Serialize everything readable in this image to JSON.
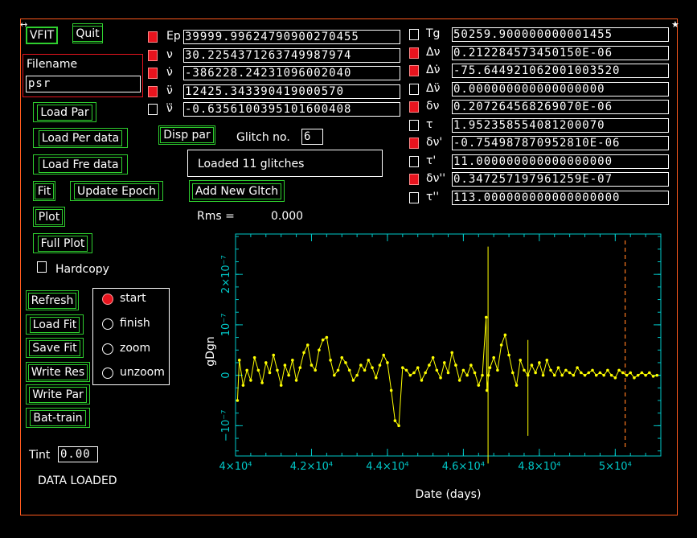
{
  "app": {
    "title": "VFIT",
    "quit_label": "Quit",
    "status": "DATA LOADED"
  },
  "file": {
    "label": "Filename",
    "value": "psr"
  },
  "buttons": {
    "load_par": "Load Par",
    "load_per": "Load Per data",
    "load_fre": "Load Fre data",
    "fit": "Fit",
    "update_epoch": "Update Epoch",
    "plot": "Plot",
    "full_plot": "Full Plot",
    "hardcopy": "Hardcopy",
    "refresh": "Refresh",
    "load_fit": "Load Fit",
    "save_fit": "Save Fit",
    "write_res": "Write Res",
    "write_par": "Write Par",
    "bat_train": "Bat-train",
    "disp_par": "Disp par",
    "add_glitch": "Add New Gltch"
  },
  "glitch": {
    "label": "Glitch no.",
    "value": "6",
    "message": "Loaded 11 glitches"
  },
  "rms": {
    "label": "Rms =",
    "value": "0.000"
  },
  "tint": {
    "label": "Tint",
    "value": "0.00"
  },
  "modes": [
    {
      "label": "start",
      "selected": true
    },
    {
      "label": "finish",
      "selected": false
    },
    {
      "label": "zoom",
      "selected": false
    },
    {
      "label": "unzoom",
      "selected": false
    }
  ],
  "params_left": [
    {
      "name": "Ep",
      "checked": true,
      "value": "39999.99624790900270455"
    },
    {
      "name": "ν",
      "checked": true,
      "value": "30.2254371263749987974"
    },
    {
      "name": "ν̇",
      "checked": true,
      "value": "-386228.24231096002040"
    },
    {
      "name": "ν̈",
      "checked": true,
      "value": "12425.343390419000570"
    },
    {
      "name": "ν⃛",
      "checked": false,
      "value": "-0.6356100395101600408"
    }
  ],
  "params_right": [
    {
      "name": "Tg",
      "checked": false,
      "value": "50259.900000000001455"
    },
    {
      "name": "Δν",
      "checked": true,
      "value": "0.212284573450150E-06"
    },
    {
      "name": "Δν̇",
      "checked": true,
      "value": "-75.644921062001003520"
    },
    {
      "name": "Δν̈",
      "checked": false,
      "value": "0.000000000000000000"
    },
    {
      "name": "δν",
      "checked": true,
      "value": "0.207264568269070E-06"
    },
    {
      "name": "τ",
      "checked": false,
      "value": "1.952358554081200070"
    },
    {
      "name": "δν'",
      "checked": true,
      "value": "-0.754987870952810E-06"
    },
    {
      "name": "τ'",
      "checked": false,
      "value": "11.000000000000000000"
    },
    {
      "name": "δν''",
      "checked": true,
      "value": "0.347257197961259E-07"
    },
    {
      "name": "τ''",
      "checked": false,
      "value": "113.000000000000000000"
    }
  ],
  "colors": {
    "axis": "#00c8c8",
    "data": "#ffff00",
    "marker": "#ff7a1e",
    "frame": "#ff5a1e",
    "button": "#2fd02f"
  },
  "chart_data": {
    "type": "line",
    "xlabel": "Date (days)",
    "ylabel": "gDgn",
    "xlim": [
      40000,
      51200
    ],
    "ylim": [
      -1.6e-07,
      2.8e-07
    ],
    "xticks": [
      40000,
      42000,
      44000,
      46000,
      48000,
      50000
    ],
    "xtick_labels": [
      "4×10⁴",
      "4.2×10⁴",
      "4.4×10⁴",
      "4.6×10⁴",
      "4.8×10⁴",
      "5×10⁴"
    ],
    "yticks": [
      -1e-07,
      0,
      1e-07,
      2e-07
    ],
    "ytick_labels": [
      "−10⁻⁷",
      "0",
      "10⁻⁷",
      "2×10⁻⁷"
    ],
    "glitch_marker_x": 50259.9,
    "series": [
      {
        "x": [
          40050,
          40100,
          40200,
          40300,
          40400,
          40500,
          40600,
          40700,
          40800,
          40900,
          41000,
          41100,
          41200,
          41300,
          41400,
          41500,
          41600,
          41700,
          41800,
          41900,
          42000,
          42100,
          42200,
          42300,
          42400,
          42500,
          42600,
          42700,
          42800,
          42900,
          43000,
          43100,
          43200,
          43300,
          43400,
          43500,
          43600,
          43700,
          43800,
          43900,
          44000,
          44100,
          44200,
          44300,
          44400,
          44500,
          44600,
          44700,
          44800,
          44900,
          45000,
          45100,
          45200,
          45300,
          45400,
          45500,
          45600,
          45700,
          45800,
          45900,
          46000,
          46100,
          46200,
          46300,
          46400,
          46500,
          46600,
          46620,
          46660,
          46700,
          46800,
          46900,
          47000,
          47100,
          47200,
          47300,
          47400,
          47500,
          47600,
          47700,
          47800,
          47900,
          48000,
          48100,
          48200,
          48300,
          48400,
          48500,
          48600,
          48700,
          48800,
          48900,
          49000,
          49100,
          49200,
          49300,
          49400,
          49500,
          49600,
          49700,
          49800,
          49900,
          50000,
          50100,
          50200,
          50300,
          50400,
          50500,
          50600,
          50700,
          50800,
          50900,
          51000,
          51100
        ],
        "y": [
          -5e-08,
          3e-08,
          -2e-08,
          1e-08,
          -1e-08,
          3.5e-08,
          1e-08,
          -1.5e-08,
          2.5e-08,
          5e-09,
          4e-08,
          1e-08,
          -2e-08,
          2e-08,
          0.0,
          3e-08,
          -1e-08,
          1.5e-08,
          4.5e-08,
          6e-08,
          2e-08,
          1e-08,
          5e-08,
          7e-08,
          7.5e-08,
          3e-08,
          0.0,
          1e-08,
          3.5e-08,
          2.5e-08,
          1e-08,
          -1e-08,
          0.0,
          2e-08,
          1e-08,
          3e-08,
          1.5e-08,
          -5e-09,
          2e-08,
          4e-08,
          2.5e-08,
          -3e-08,
          -9e-08,
          -1e-07,
          1.5e-08,
          1e-08,
          0.0,
          5e-09,
          1.5e-08,
          -1e-08,
          5e-09,
          2e-08,
          3.5e-08,
          1e-08,
          -5e-09,
          2.5e-08,
          5e-09,
          4.5e-08,
          2e-08,
          -1e-08,
          1e-08,
          0.0,
          2e-08,
          5e-09,
          -2e-08,
          0.0,
          1.15e-07,
          -3e-08,
          0.0,
          1.5e-08,
          3.5e-08,
          1e-08,
          6e-08,
          8e-08,
          4e-08,
          5e-09,
          -2e-08,
          3e-08,
          1e-08,
          0.0,
          2e-08,
          5e-09,
          2.5e-08,
          0.0,
          3e-08,
          1e-08,
          0.0,
          1.5e-08,
          0.0,
          1e-08,
          5e-09,
          0.0,
          1.5e-08,
          5e-09,
          0.0,
          5e-09,
          1e-08,
          0.0,
          5e-09,
          0.0,
          1e-08,
          0.0,
          -5e-09,
          1e-08,
          5e-09,
          0.0,
          5e-09,
          -5e-09,
          0.0,
          5e-09,
          0.0,
          5e-09,
          -2e-09,
          0.0
        ]
      }
    ]
  }
}
